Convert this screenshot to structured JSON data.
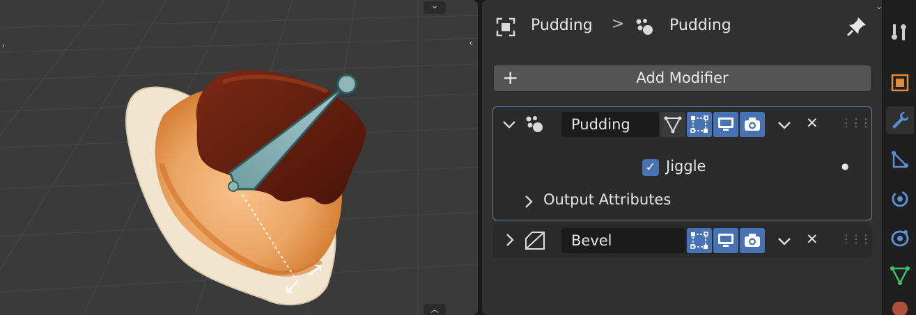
{
  "breadcrumb": {
    "object": "Pudding",
    "separator": ">",
    "data": "Pudding"
  },
  "add_modifier": {
    "plus": "+",
    "label": "Add Modifier"
  },
  "modifiers": [
    {
      "name": "Pudding",
      "expanded": true,
      "checkbox_label": "Jiggle",
      "subpanel": "Output Attributes"
    },
    {
      "name": "Bevel",
      "expanded": false
    }
  ],
  "glyphs": {
    "chev_down": "⌄",
    "chev_right": "›",
    "close": "✕",
    "check": "✓",
    "grip": "⋮⋮⋮",
    "dot": "●"
  },
  "colors": {
    "accent": "#4772b3",
    "panel": "#303030",
    "field": "#1b1b1b",
    "viewport": "#3a3a3a"
  },
  "property_tabs": [
    "tool-tab",
    "object-tab",
    "modifier-tab",
    "particles-tab",
    "physics-tab",
    "constraints-tab",
    "data-tab"
  ]
}
